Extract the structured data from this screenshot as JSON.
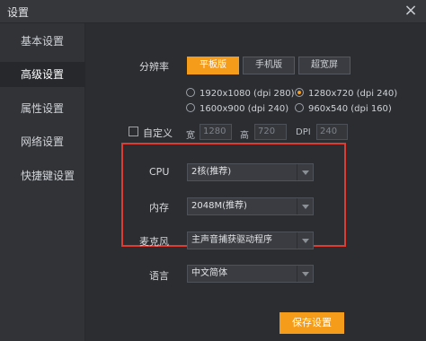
{
  "window": {
    "title": "设置",
    "close_icon": "close-icon"
  },
  "sidebar": {
    "items": [
      {
        "label": "基本设置",
        "active": false
      },
      {
        "label": "高级设置",
        "active": true
      },
      {
        "label": "属性设置",
        "active": false
      },
      {
        "label": "网络设置",
        "active": false
      },
      {
        "label": "快捷键设置",
        "active": false
      }
    ]
  },
  "resolution": {
    "label": "分辨率",
    "tabs": [
      {
        "label": "平板版",
        "active": true
      },
      {
        "label": "手机版",
        "active": false
      },
      {
        "label": "超宽屏",
        "active": false
      }
    ],
    "options": [
      {
        "label": "1920x1080 (dpi 280)",
        "checked": false
      },
      {
        "label": "1280x720 (dpi 240)",
        "checked": true
      },
      {
        "label": "1600x900 (dpi 240)",
        "checked": false
      },
      {
        "label": "960x540 (dpi 160)",
        "checked": false
      }
    ],
    "custom": {
      "checkbox_label": "自定义",
      "width_label": "宽",
      "width_value": "1280",
      "height_label": "高",
      "height_value": "720",
      "dpi_label": "DPI",
      "dpi_value": "240"
    }
  },
  "performance": {
    "cpu_label": "CPU",
    "cpu_value": "2核(推荐)",
    "memory_label": "内存",
    "memory_value": "2048M(推荐)"
  },
  "audio": {
    "mic_label": "麦克风",
    "mic_value": "主声音捕获驱动程序"
  },
  "language": {
    "label": "语言",
    "value": "中文简体"
  },
  "actions": {
    "save_label": "保存设置"
  },
  "colors": {
    "accent": "#f59c1a",
    "highlight_box": "#e03a35"
  }
}
